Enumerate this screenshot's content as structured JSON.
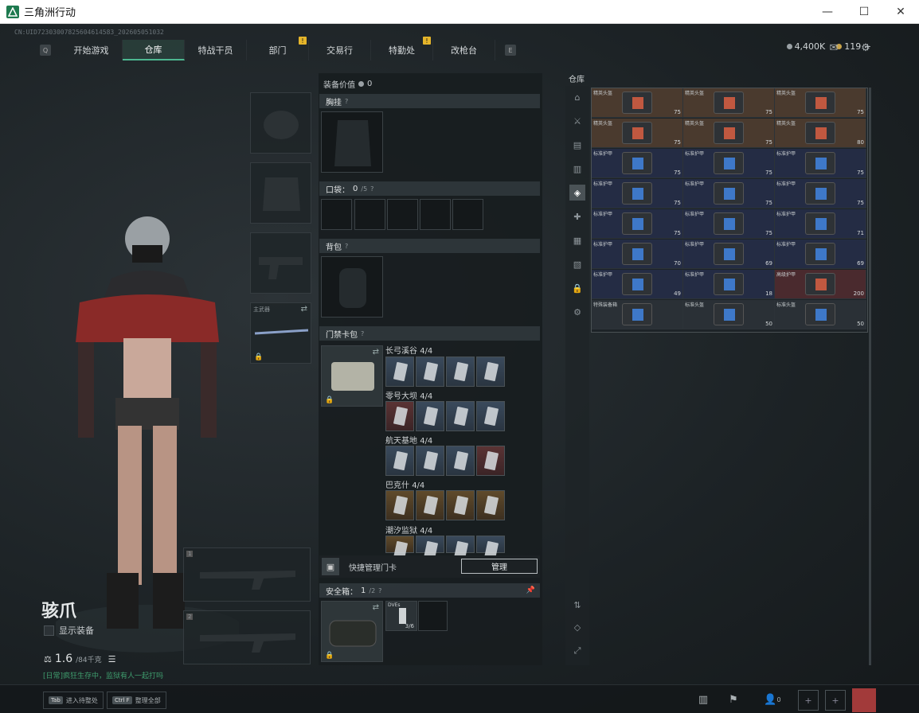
{
  "window": {
    "title": "三角洲行动",
    "minimize": "—",
    "maximize": "☐",
    "close": "✕"
  },
  "uid": "CN:UID7230300782560461458​3_202605051032",
  "nav": {
    "left_key": "Q",
    "right_key": "E",
    "tabs": [
      {
        "label": "开始游戏",
        "warn": ""
      },
      {
        "label": "仓库",
        "warn": ""
      },
      {
        "label": "特战干员",
        "warn": ""
      },
      {
        "label": "部门",
        "warn": "!"
      },
      {
        "label": "交易行",
        "warn": ""
      },
      {
        "label": "特勤处",
        "warn": "!"
      },
      {
        "label": "改枪台",
        "warn": ""
      }
    ],
    "active": 1
  },
  "resources": {
    "silver": "4,400K",
    "gold": "119",
    "plus": "+"
  },
  "equip_slots": {
    "melee_label": "主武器",
    "weapon1": "1",
    "weapon2": "2"
  },
  "character": {
    "name": "骇爪",
    "show_equip": "显示装备",
    "weight": "1.6",
    "weight_max": "/84千克",
    "status": "[日常]疯狂生存中，监狱有人一起打吗"
  },
  "middle": {
    "equip_value_label": "装备价值",
    "equip_value": "0",
    "chest": "胸挂",
    "pocket": "口袋：",
    "pocket_count": "0",
    "pocket_max": "/5",
    "backpack": "背包",
    "keycard": "门禁卡包",
    "help": "?",
    "quick_manage": "快捷管理门卡",
    "manage_btn": "管理",
    "safebox": "安全箱：",
    "safebox_count": "1",
    "safebox_max": "/2",
    "safebox_item": "3/6",
    "safebox_item_name": "DVEs"
  },
  "maps": [
    {
      "name": "长弓溪谷",
      "count": "4/4"
    },
    {
      "name": "零号大坝",
      "count": "4/4"
    },
    {
      "name": "航天基地",
      "count": "4/4"
    },
    {
      "name": "巴克什",
      "count": "4/4"
    },
    {
      "name": "潮汐监狱",
      "count": "4/4"
    }
  ],
  "warehouse": {
    "label": "仓库",
    "rows": [
      [
        {
          "name": "精英头盔",
          "dur": "75",
          "type": "brown"
        },
        {
          "name": "精英头盔",
          "dur": "75",
          "type": "brown"
        },
        {
          "name": "精英头盔",
          "dur": "75",
          "type": "brown"
        }
      ],
      [
        {
          "name": "精英头盔",
          "dur": "75",
          "type": "brown"
        },
        {
          "name": "精英头盔",
          "dur": "75",
          "type": "brown"
        },
        {
          "name": "精英头盔",
          "dur": "80",
          "type": "brown"
        }
      ],
      [
        {
          "name": "标准护甲",
          "dur": "75",
          "type": "blue"
        },
        {
          "name": "标准护甲",
          "dur": "75",
          "type": "blue"
        },
        {
          "name": "标准护甲",
          "dur": "75",
          "type": "blue"
        }
      ],
      [
        {
          "name": "标准护甲",
          "dur": "75",
          "type": "blue"
        },
        {
          "name": "标准护甲",
          "dur": "75",
          "type": "blue"
        },
        {
          "name": "标准护甲",
          "dur": "75",
          "type": "blue"
        }
      ],
      [
        {
          "name": "标准护甲",
          "dur": "75",
          "type": "blue"
        },
        {
          "name": "标准护甲",
          "dur": "75",
          "type": "blue"
        },
        {
          "name": "标准护甲",
          "dur": "71",
          "type": "blue"
        }
      ],
      [
        {
          "name": "标准护甲",
          "dur": "70",
          "type": "blue"
        },
        {
          "name": "标准护甲",
          "dur": "69",
          "type": "blue"
        },
        {
          "name": "标准护甲",
          "dur": "69",
          "type": "blue"
        }
      ],
      [
        {
          "name": "标准护甲",
          "dur": "49",
          "type": "blue"
        },
        {
          "name": "标准护甲",
          "dur": "18",
          "type": "blue"
        },
        {
          "name": "高级护甲",
          "dur": "200",
          "type": "redbig"
        }
      ],
      [
        {
          "name": "特殊装备箱",
          "dur": "",
          "type": "dark"
        },
        {
          "name": "标准头盔",
          "dur": "50",
          "type": "dark"
        },
        {
          "name": "标准头盔",
          "dur": "50",
          "type": "dark"
        }
      ]
    ],
    "big_armor_dur": "200",
    "last_dur": "50"
  },
  "bottom": {
    "hint1_key": "Tab",
    "hint1": "进入待整处",
    "hint2_key": "Ctrl F",
    "hint2": "整理全部",
    "friends": "0"
  }
}
